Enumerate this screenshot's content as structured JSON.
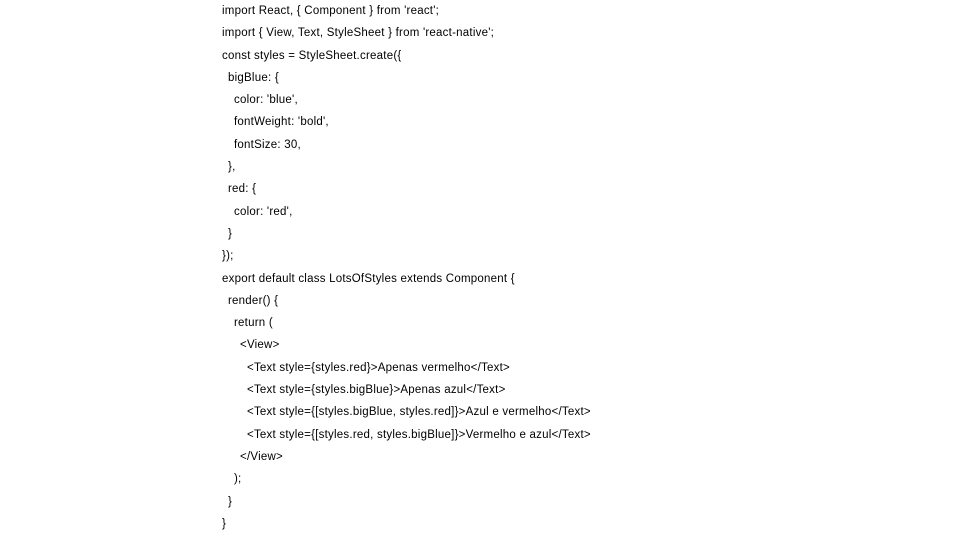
{
  "page": {
    "background_color": "#ffffff",
    "text_color": "#000000",
    "language": "jsx",
    "line_count": 24
  },
  "code": {
    "lines": [
      {
        "text": "import React, { Component } from 'react';",
        "indent": 0
      },
      {
        "text": "import { View, Text, StyleSheet } from 'react-native';",
        "indent": 0
      },
      {
        "text": "const styles = StyleSheet.create({",
        "indent": 0
      },
      {
        "text": "bigBlue: {",
        "indent": 1
      },
      {
        "text": "color: 'blue',",
        "indent": 2
      },
      {
        "text": "fontWeight: 'bold',",
        "indent": 2
      },
      {
        "text": "fontSize: 30,",
        "indent": 2
      },
      {
        "text": "},",
        "indent": 1
      },
      {
        "text": "red: {",
        "indent": 1
      },
      {
        "text": "color: 'red',",
        "indent": 2
      },
      {
        "text": "}",
        "indent": 1
      },
      {
        "text": "});",
        "indent": 0
      },
      {
        "text": "export default class LotsOfStyles extends Component {",
        "indent": 0
      },
      {
        "text": "render() {",
        "indent": 1
      },
      {
        "text": "return (",
        "indent": 2
      },
      {
        "text": "<View>",
        "indent": 3
      },
      {
        "text": "<Text style={styles.red}>Apenas vermelho</Text>",
        "indent": 4
      },
      {
        "text": "<Text style={styles.bigBlue}>Apenas azul</Text>",
        "indent": 4
      },
      {
        "text": "<Text style={[styles.bigBlue, styles.red]}>Azul e vermelho</Text>",
        "indent": 4
      },
      {
        "text": "<Text style={[styles.red, styles.bigBlue]}>Vermelho e azul</Text>",
        "indent": 4
      },
      {
        "text": "</View>",
        "indent": 3
      },
      {
        "text": ");",
        "indent": 2
      },
      {
        "text": "}",
        "indent": 1
      },
      {
        "text": "}",
        "indent": 0
      }
    ]
  }
}
